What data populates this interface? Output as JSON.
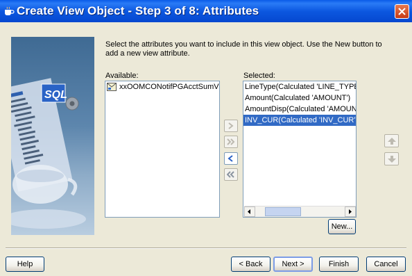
{
  "window": {
    "title": "Create View Object - Step 3 of 8: Attributes"
  },
  "instructions": "Select the attributes you want to include in this view object.  Use the New button to add a new view attribute.",
  "available": {
    "label": "Available:",
    "items": [
      "xxOOMCONotifPGAcctSumVO"
    ]
  },
  "selected": {
    "label": "Selected:",
    "items": [
      "LineType(Calculated 'LINE_TYPE')",
      "Amount(Calculated 'AMOUNT')",
      "AmountDisp(Calculated 'AMOUNT",
      "INV_CUR(Calculated 'INV_CUR')"
    ],
    "selected_index": 3
  },
  "buttons": {
    "new": "New...",
    "help": "Help",
    "back": "< Back",
    "next": "Next >",
    "finish": "Finish",
    "cancel": "Cancel"
  },
  "icons": {
    "add": "chevron-right-icon",
    "add_all": "double-chevron-right-icon",
    "remove": "chevron-left-icon",
    "remove_all": "double-chevron-left-icon",
    "move_up": "arrow-up-icon",
    "move_down": "arrow-down-icon"
  }
}
